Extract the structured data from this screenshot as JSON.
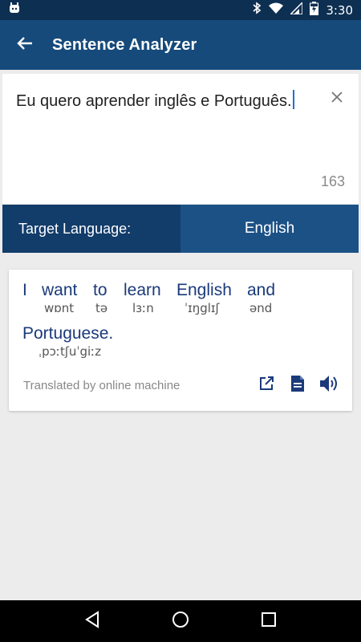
{
  "status_bar": {
    "time": "3:30",
    "battery_level": 0.75
  },
  "app_bar": {
    "title": "Sentence Analyzer"
  },
  "input": {
    "text": "Eu quero aprender inglês e Português.",
    "char_count": "163"
  },
  "language": {
    "label": "Target Language:",
    "value": "English"
  },
  "translation": {
    "words": [
      {
        "word": "I",
        "phonetic": ""
      },
      {
        "word": "want",
        "phonetic": "wɒnt"
      },
      {
        "word": "to",
        "phonetic": "tə"
      },
      {
        "word": "learn",
        "phonetic": "lɜːn"
      },
      {
        "word": "English",
        "phonetic": "ˈɪŋglɪʃ"
      },
      {
        "word": "and",
        "phonetic": "ənd"
      },
      {
        "word": "Portuguese.",
        "phonetic": "ˌpɔːtʃuˈgiːz"
      }
    ],
    "credit": "Translated by online machine"
  },
  "colors": {
    "status_bar": "#0d2f52",
    "app_bar": "#164a7b",
    "lang_label_bg": "#123c6a",
    "lang_value_bg": "#1c5186",
    "word_text": "#1b3a7a",
    "icon": "#1b3a7a"
  }
}
